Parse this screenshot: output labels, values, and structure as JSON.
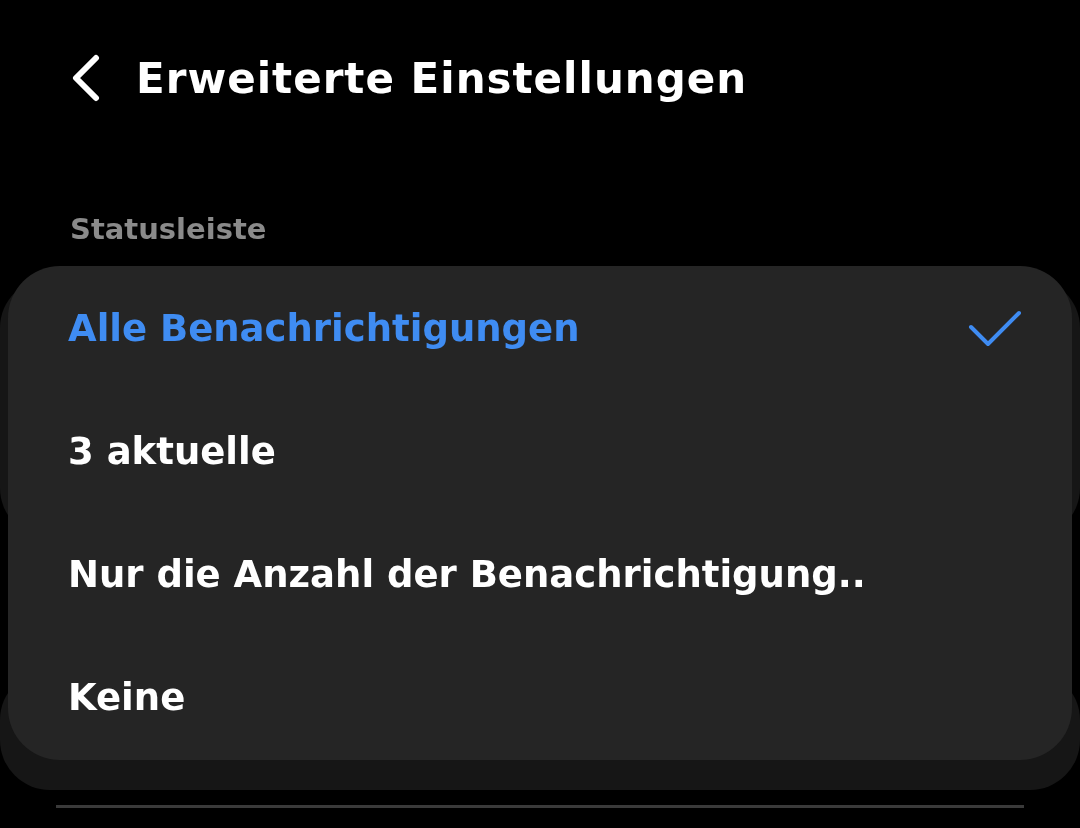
{
  "header": {
    "title": "Erweiterte Einstellungen"
  },
  "section": {
    "label": "Statusleiste"
  },
  "popup": {
    "options": [
      {
        "label": "Alle Benachrichtigungen",
        "selected": true
      },
      {
        "label": "3 aktuelle",
        "selected": false
      },
      {
        "label": "Nur die Anzahl der Benachrichtigung..",
        "selected": false
      },
      {
        "label": "Keine",
        "selected": false
      }
    ]
  }
}
